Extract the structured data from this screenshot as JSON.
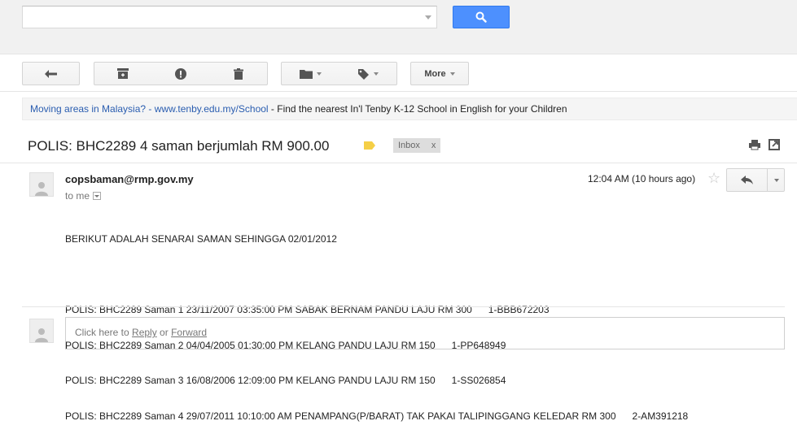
{
  "search": {
    "placeholder": ""
  },
  "toolbar": {
    "more_label": "More"
  },
  "ad": {
    "link_text": "Moving areas in Malaysia? - www.tenby.edu.my/School",
    "rest_text": " - Find the nearest In'l Tenby K-12 School in English for your Children"
  },
  "message": {
    "subject": "POLIS: BHC2289 4 saman berjumlah RM 900.00",
    "label": "Inbox",
    "label_remove": "x",
    "sender": "copsbaman@rmp.gov.my",
    "recipient": "to me",
    "time": "12:04 AM (10 hours ago)",
    "body_intro": "BERIKUT ADALAH SENARAI SAMAN SEHINGGA 02/01/2012",
    "body_lines": [
      "POLIS: BHC2289 Saman 1 23/11/2007 03:35:00 PM SABAK BERNAM PANDU LAJU RM 300      1-BBB672203",
      "POLIS: BHC2289 Saman 2 04/04/2005 01:30:00 PM KELANG PANDU LAJU RM 150      1-PP648949",
      "POLIS: BHC2289 Saman 3 16/08/2006 12:09:00 PM KELANG PANDU LAJU RM 150      1-SS026854",
      "POLIS: BHC2289 Saman 4 29/07/2011 10:10:00 AM PENAMPANG(P/BARAT) TAK PAKAI TALIPINGGANG KELEDAR RM 300      2-AM391218"
    ]
  },
  "reply": {
    "prefix": "Click here to ",
    "reply_link": "Reply",
    "or": " or ",
    "forward_link": "Forward"
  },
  "colors": {
    "search_button": "#4d90fe",
    "ad_link": "#2a5db0",
    "label_tag": "#f5cf46"
  },
  "icons": [
    "search-icon",
    "back-arrow-icon",
    "archive-icon",
    "spam-icon",
    "trash-icon",
    "folder-icon",
    "label-icon",
    "print-icon",
    "new-window-icon",
    "avatar-icon",
    "star-icon",
    "reply-icon"
  ]
}
